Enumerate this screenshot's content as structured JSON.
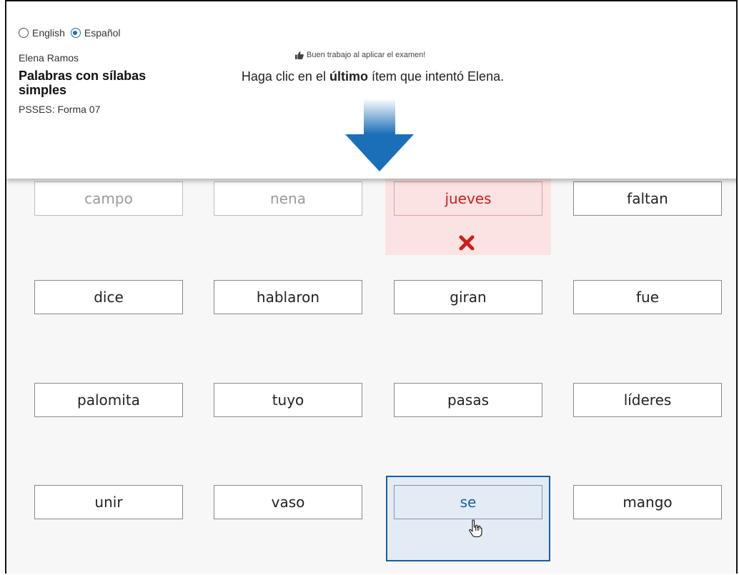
{
  "language": {
    "options": [
      "English",
      "Español"
    ],
    "selected": "Español"
  },
  "student_name": "Elena Ramos",
  "test_title": "Palabras con sílabas simples",
  "form_id": "PSSES: Forma 07",
  "praise": "Buen trabajo al aplicar el examen!",
  "instruction": {
    "before": "Haga clic en el ",
    "bold": "último",
    "after": " ítem que intentó Elena."
  },
  "words": [
    [
      "campo",
      "nena",
      "jueves",
      "faltan"
    ],
    [
      "dice",
      "hablaron",
      "giran",
      "fue"
    ],
    [
      "palomita",
      "tuyo",
      "pasas",
      "líderes"
    ],
    [
      "unir",
      "vaso",
      "se",
      "mango"
    ]
  ],
  "colors": {
    "accent": "#1a6fb8",
    "error": "#d11c1c",
    "error_bg": "#fbe3e3",
    "selected_bg": "#e3ebf4"
  },
  "icons": {
    "praise": "thumbs-up-icon",
    "error": "x-mark-icon",
    "pointer": "arrow-down-icon",
    "cursor": "hand-cursor-icon"
  }
}
